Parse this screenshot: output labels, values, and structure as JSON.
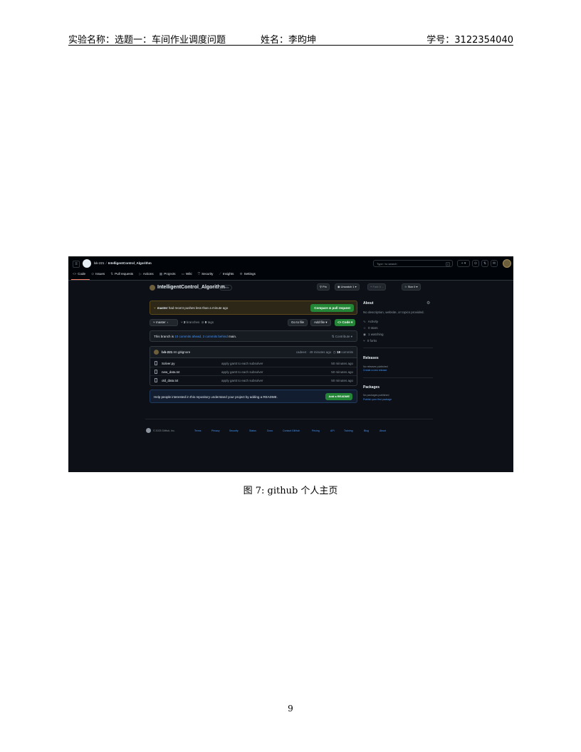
{
  "header": {
    "experiment": "实验名称：选题一：车间作业调度问题",
    "name": "姓名：李昀坤",
    "student_id": "学号：3122354040"
  },
  "figure": {
    "topbar": {
      "owner": "lxk-221",
      "separator": "/",
      "repo": "IntelligentControl_Algorithm",
      "search_placeholder": "Type / to search",
      "plus": "+ ▾"
    },
    "nav": {
      "items": [
        {
          "icon": "<>",
          "label": "Code"
        },
        {
          "icon": "⊙",
          "label": "Issues"
        },
        {
          "icon": "⇅",
          "label": "Pull requests"
        },
        {
          "icon": "▷",
          "label": "Actions"
        },
        {
          "icon": "▦",
          "label": "Projects"
        },
        {
          "icon": "▭",
          "label": "Wiki"
        },
        {
          "icon": "⛉",
          "label": "Security"
        },
        {
          "icon": "⟋",
          "label": "Insights"
        },
        {
          "icon": "⚙",
          "label": "Settings"
        }
      ]
    },
    "repo": {
      "name": "IntelligentControl_Algorithm",
      "visibility": "Public",
      "pin": "Pin",
      "unwatch": "Unwatch",
      "unwatch_count": "1",
      "fork": "Fork",
      "fork_count": "0",
      "star": "Star",
      "star_count": "0"
    },
    "push_banner": {
      "branch": "master",
      "text": "had recent pushes less than a minute ago",
      "button": "Compare & pull request"
    },
    "branch_bar": {
      "branch": "master",
      "branches_count": "2",
      "branches_label": "branches",
      "tags_count": "0",
      "tags_label": "tags",
      "go_to_file": "Go to file",
      "add_file": "Add file ▾",
      "code": "<> Code ▾"
    },
    "sync": {
      "prefix": "This branch is",
      "ahead": "10 commits ahead,",
      "behind": "2 commits behind",
      "suffix": "main.",
      "contribute": "Contribute ▾"
    },
    "commit": {
      "author": "lxk-221",
      "message": "rm gitignore",
      "hash_time": "cadee4 · 49 minutes ago",
      "commits_count": "18",
      "commits_label": "commits"
    },
    "files": [
      {
        "name": "Solver.py",
        "message": "apply gantt to each subsolver",
        "time": "50 minutes ago"
      },
      {
        "name": "new_data.txt",
        "message": "apply gantt to each subsolver",
        "time": "50 minutes ago"
      },
      {
        "name": "old_data.txt",
        "message": "apply gantt to each subsolver",
        "time": "50 minutes ago"
      }
    ],
    "readme": {
      "text": "Help people interested in this repository understand your project by adding a README.",
      "button": "Add a README"
    },
    "sidebar": {
      "about_title": "About",
      "about_desc": "No description, website, or topics provided.",
      "activity": "Activity",
      "stars": "0 stars",
      "watching": "1 watching",
      "forks": "0 forks",
      "releases_title": "Releases",
      "releases_none": "No releases published",
      "releases_link": "Create a new release",
      "packages_title": "Packages",
      "packages_none": "No packages published",
      "packages_link": "Publish your first package"
    },
    "footer": {
      "copyright": "© 2023 GitHub, Inc.",
      "links": [
        "Terms",
        "Privacy",
        "Security",
        "Status",
        "Docs",
        "Contact GitHub",
        "Pricing",
        "API",
        "Training",
        "Blog",
        "About"
      ]
    }
  },
  "caption": "图 7: github 个人主页",
  "page_number": "9"
}
